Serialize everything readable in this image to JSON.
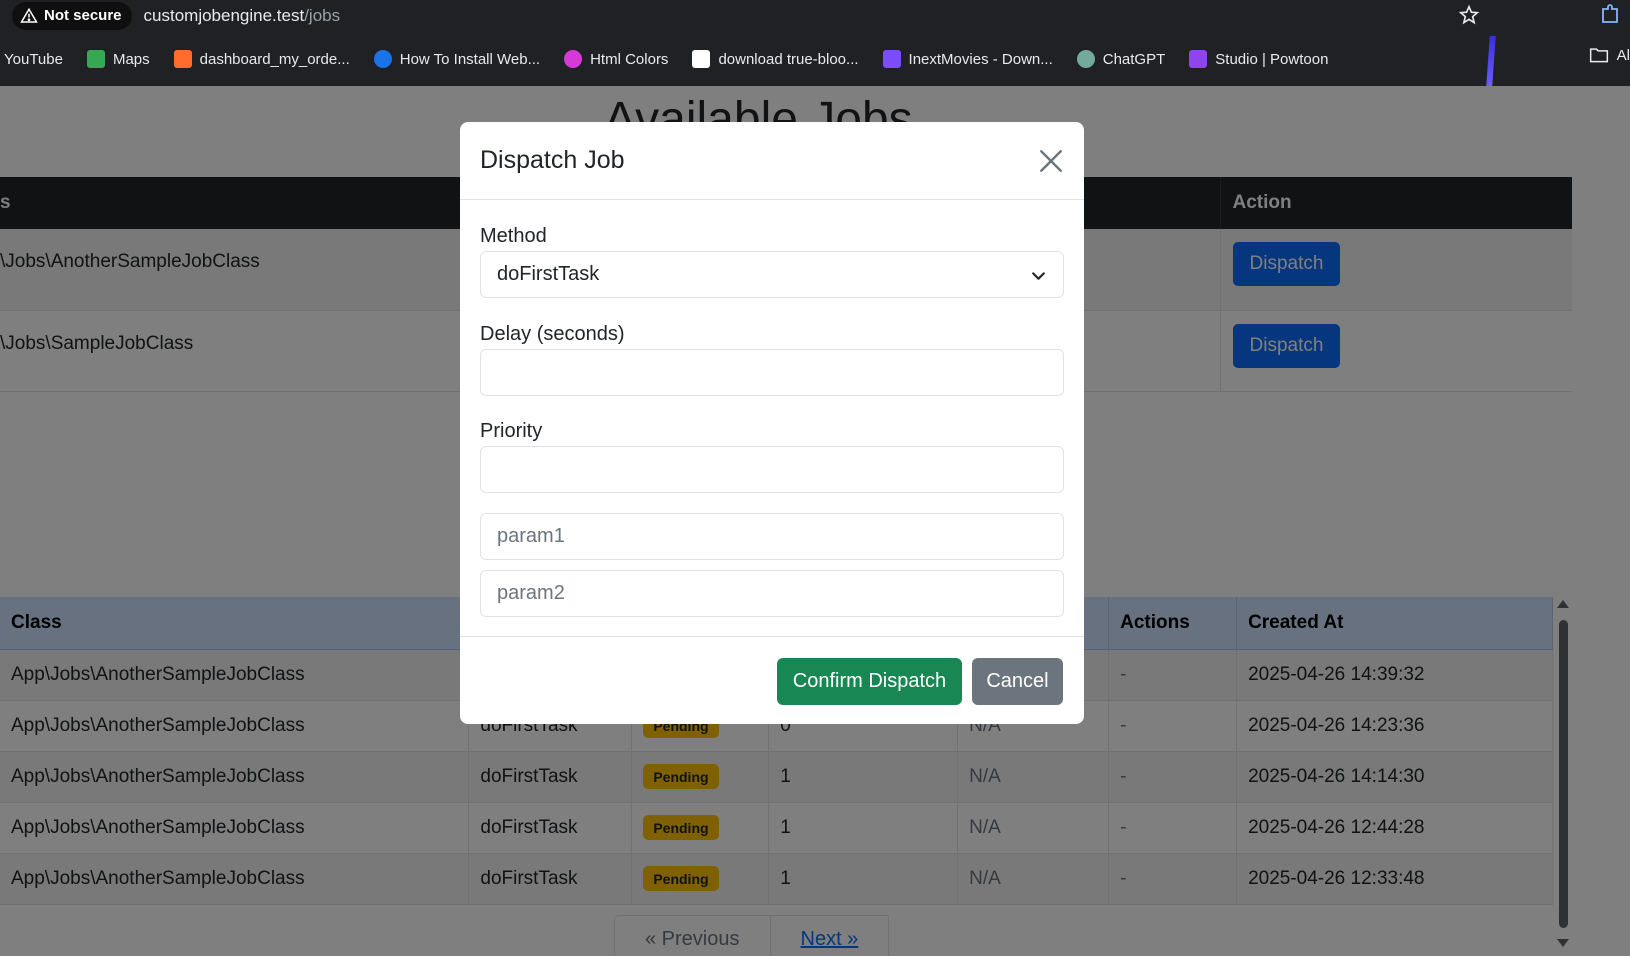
{
  "browser": {
    "security_label": "Not secure",
    "url_host": "customjobengine.test",
    "url_path": "/jobs",
    "bookmarks": [
      {
        "label": "YouTube",
        "icon": "youtube-icon",
        "color": "#ff0000"
      },
      {
        "label": "Maps",
        "icon": "maps-icon",
        "color": "#34a853"
      },
      {
        "label": "dashboard_my_orde...",
        "icon": "cpanel-icon",
        "color": "#ff6c2c"
      },
      {
        "label": "How To Install Web...",
        "icon": "loading-icon",
        "color": "#1a73e8"
      },
      {
        "label": "Html Colors",
        "icon": "circle-icon",
        "color": "#d63ad6"
      },
      {
        "label": "download true-bloo...",
        "icon": "page-icon",
        "color": "#ffffff"
      },
      {
        "label": "InextMovies - Down...",
        "icon": "clapper-icon",
        "color": "#7c4dff"
      },
      {
        "label": "ChatGPT",
        "icon": "chatgpt-icon",
        "color": "#74aa9c"
      },
      {
        "label": "Studio | Powtoon",
        "icon": "powtoon-icon",
        "color": "#8e44ef"
      }
    ],
    "bookmarks_end_label": "Al"
  },
  "page": {
    "title": "Available Jobs",
    "jobs_table": {
      "headers": [
        "s",
        "Action"
      ],
      "rows": [
        {
          "class": "\\Jobs\\AnotherSampleJobClass",
          "action": "Dispatch"
        },
        {
          "class": "\\Jobs\\SampleJobClass",
          "action": "Dispatch"
        }
      ]
    },
    "history_table": {
      "headers": [
        "Class",
        "",
        "",
        "",
        "",
        "Actions",
        "Created At"
      ],
      "rows": [
        {
          "class": "App\\Jobs\\AnotherSampleJobClass",
          "method": "",
          "status": "",
          "attempts": "",
          "result": "",
          "actions": "-",
          "created": "2025-04-26 14:39:32"
        },
        {
          "class": "App\\Jobs\\AnotherSampleJobClass",
          "method": "doFirstTask",
          "status": "Pending",
          "attempts": "0",
          "result": "N/A",
          "actions": "-",
          "created": "2025-04-26 14:23:36"
        },
        {
          "class": "App\\Jobs\\AnotherSampleJobClass",
          "method": "doFirstTask",
          "status": "Pending",
          "attempts": "1",
          "result": "N/A",
          "actions": "-",
          "created": "2025-04-26 14:14:30"
        },
        {
          "class": "App\\Jobs\\AnotherSampleJobClass",
          "method": "doFirstTask",
          "status": "Pending",
          "attempts": "1",
          "result": "N/A",
          "actions": "-",
          "created": "2025-04-26 12:44:28"
        },
        {
          "class": "App\\Jobs\\AnotherSampleJobClass",
          "method": "doFirstTask",
          "status": "Pending",
          "attempts": "1",
          "result": "N/A",
          "actions": "-",
          "created": "2025-04-26 12:33:48"
        }
      ]
    },
    "pagination": {
      "previous": "« Previous",
      "next": "Next »"
    }
  },
  "modal": {
    "title": "Dispatch Job",
    "method_label": "Method",
    "method_value": "doFirstTask",
    "delay_label": "Delay (seconds)",
    "delay_value": "",
    "priority_label": "Priority",
    "priority_value": "",
    "param1_placeholder": "param1",
    "param2_placeholder": "param2",
    "confirm_label": "Confirm Dispatch",
    "cancel_label": "Cancel"
  },
  "colors": {
    "primary": "#0d6efd",
    "success": "#198754",
    "secondary": "#6c757d",
    "warning": "#ffc107",
    "table_dark": "#212529",
    "table_info": "#cfe2ff"
  }
}
